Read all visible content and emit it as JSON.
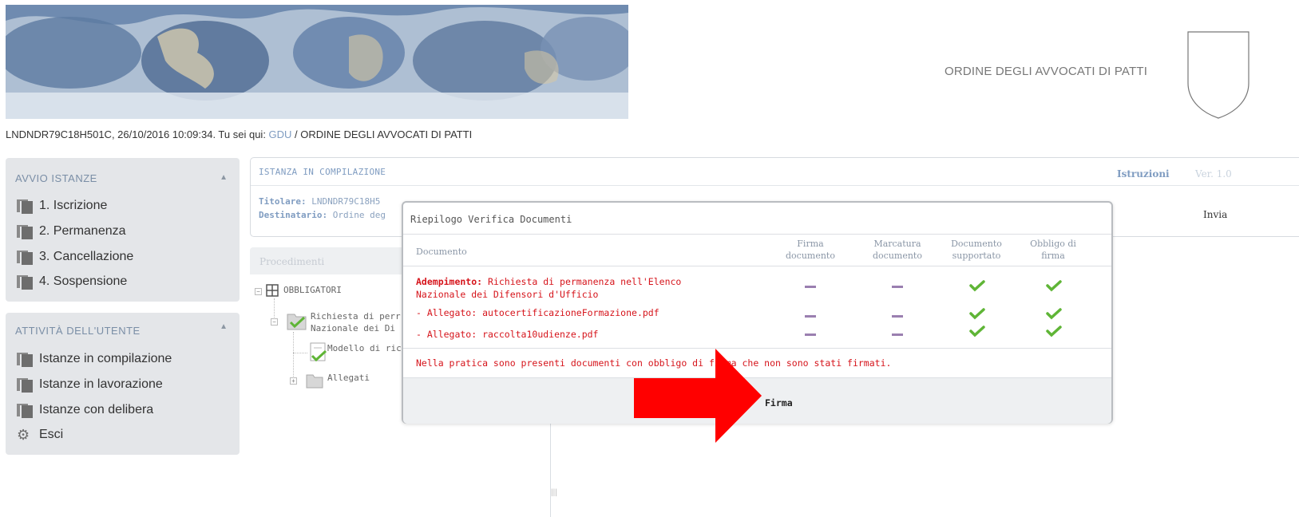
{
  "header": {
    "org_name": "ORDINE DEGLI AVVOCATI DI PATTI"
  },
  "breadcrumb": {
    "prefix": "LNDNDR79C18H501C, 26/10/2016 10:09:34. Tu sei qui: ",
    "link": "GDU",
    "separator": " / ",
    "current": "ORDINE DEGLI AVVOCATI DI PATTI"
  },
  "sidebar": {
    "avvio": {
      "title": "AVVIO ISTANZE",
      "items": [
        {
          "label": "1. Iscrizione"
        },
        {
          "label": "2. Permanenza"
        },
        {
          "label": "3. Cancellazione"
        },
        {
          "label": "4. Sospensione"
        }
      ]
    },
    "attivita": {
      "title": "ATTIVITÀ DELL'UTENTE",
      "items": [
        {
          "label": "Istanze in compilazione"
        },
        {
          "label": "Istanze in lavorazione"
        },
        {
          "label": "Istanze con delibera"
        },
        {
          "label": "Esci"
        }
      ]
    },
    "caret": "▲"
  },
  "instance": {
    "title": "ISTANZA IN COMPILAZIONE",
    "istruzioni": "Istruzioni",
    "version": "Ver. 1.0",
    "titolare_label": "Titolare:",
    "titolare_value": " LNDNDR79C18H5",
    "destinatario_label": "Destinatario:",
    "destinatario_value": " Ordine deg",
    "invia": "Invia"
  },
  "procedimenti": {
    "header": "Procedimenti",
    "tree": {
      "root": "OBBLIGATORI",
      "node1_line1": "Richiesta di perr",
      "node1_line2": "Nazionale dei Di",
      "node2": "Modello di ric",
      "node3": "Allegati"
    }
  },
  "modal": {
    "title": "Riepilogo Verifica Documenti",
    "columns": {
      "documento": "Documento",
      "firma_1": "Firma",
      "firma_2": "documento",
      "marcatura_1": "Marcatura",
      "marcatura_2": "documento",
      "supportato_1": "Documento",
      "supportato_2": "supportato",
      "obbligo_1": "Obbligo di",
      "obbligo_2": "firma"
    },
    "rows": [
      {
        "label_bold": "Adempimento:",
        "label_rest": " Richiesta di permanenza nell'Elenco",
        "label_line2": "Nazionale dei Difensori d'Ufficio"
      },
      {
        "label": "- Allegato: autocertificazioneFormazione.pdf"
      },
      {
        "label": "- Allegato: raccolta10udienze.pdf"
      }
    ],
    "warning": "Nella pratica sono presenti documenti con obbligo di firma che non sono stati firmati.",
    "firma_button": "Firma"
  },
  "colors": {
    "accent_blue": "#7f9cc1",
    "error_red": "#d6141b",
    "arrow_red": "#ff0000",
    "check_green": "#5fb536",
    "dash_purple": "#9a7fb0"
  }
}
